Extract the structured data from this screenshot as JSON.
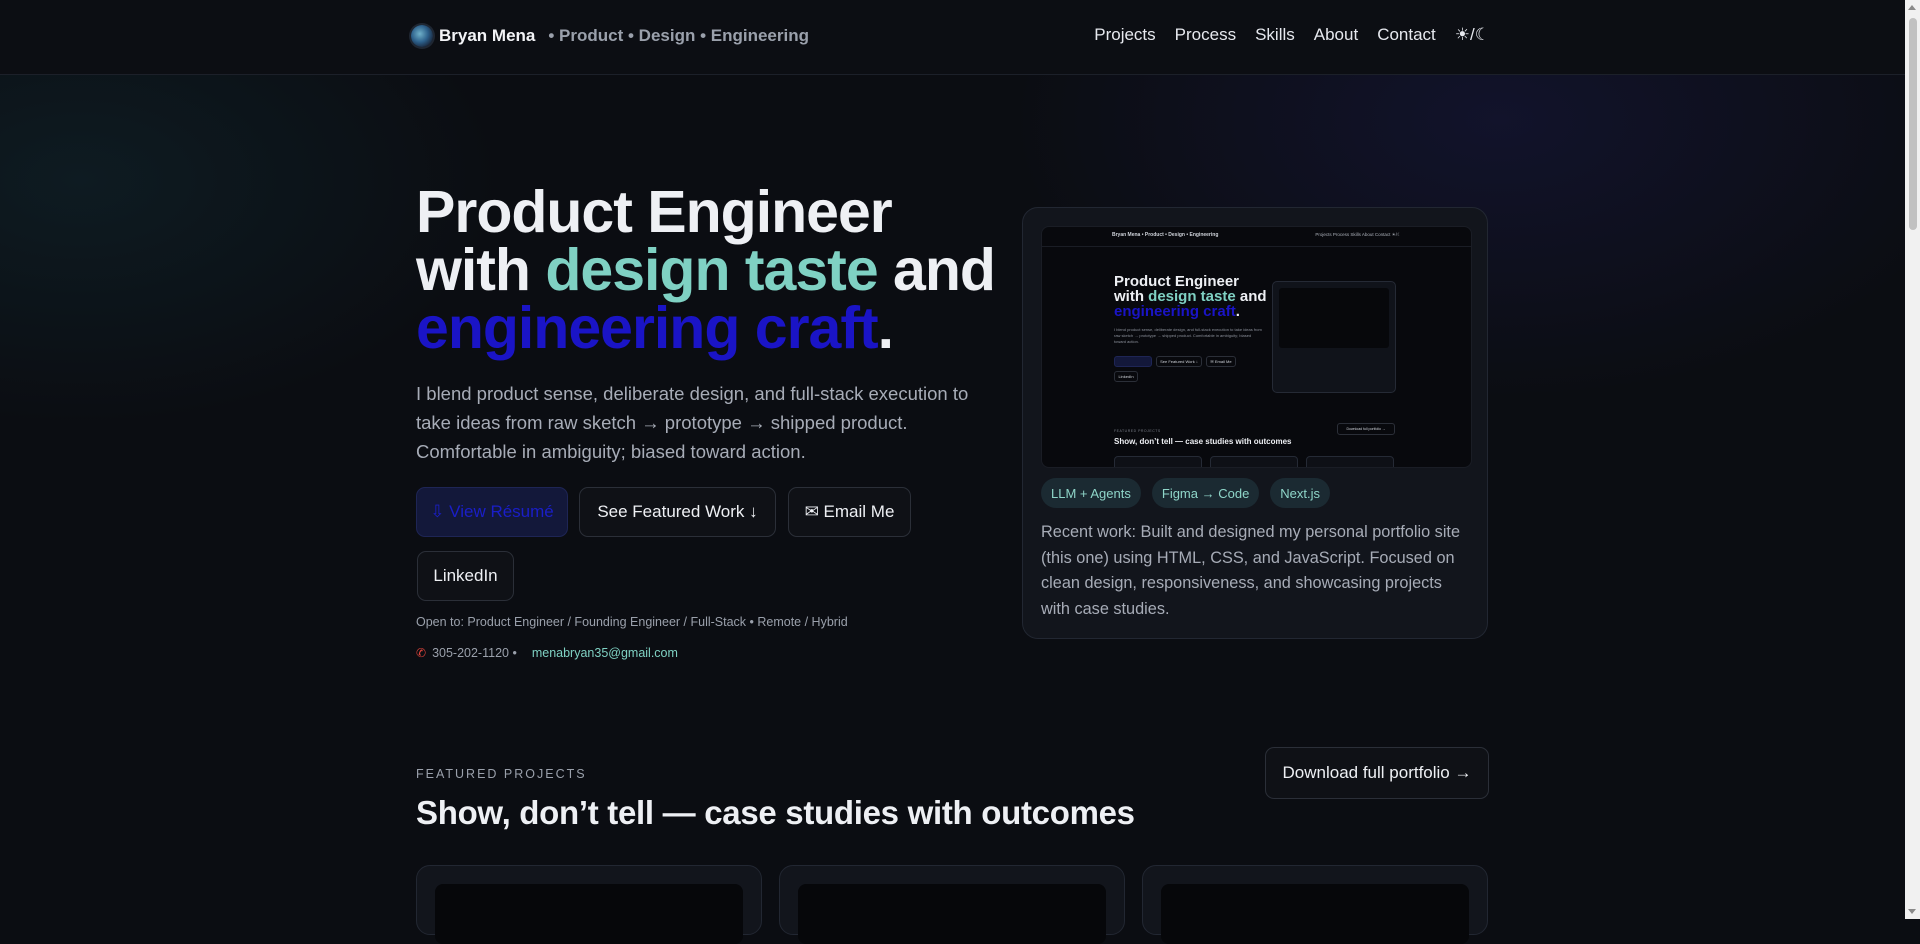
{
  "header": {
    "brand_name": "Bryan Mena",
    "brand_tagline": "• Product • Design • Engineering",
    "nav": [
      "Projects",
      "Process",
      "Skills",
      "About",
      "Contact"
    ],
    "theme_toggle": "☀/☾"
  },
  "hero": {
    "title_line1": "Product Engineer",
    "title_with": "with ",
    "title_teal": "design taste",
    "title_and": " and",
    "title_blue": "engineering craft",
    "title_period": ".",
    "subtitle": "I blend product sense, deliberate design, and full-stack execution to take ideas from raw sketch → prototype → shipped product. Comfortable in ambiguity; biased toward action.",
    "buttons": {
      "primary": "⇩ View Résumé",
      "featured": "See Featured Work ↓",
      "email": "✉ Email Me",
      "linkedin": "LinkedIn"
    },
    "open_to": "Open to: Product Engineer / Founding Engineer / Full-Stack • Remote / Hybrid",
    "phone": "305-202-1120 •",
    "email": "menabryan35@gmail.com"
  },
  "preview_card": {
    "preview": {
      "brand": "Bryan Mena • Product • Design • Engineering",
      "links": "Projects  Process  Skills  About  Contact  ☀/☾",
      "title_line1": "Product Engineer",
      "title_with": "with ",
      "title_teal": "design taste",
      "title_and": " and",
      "title_blue": "engineering craft",
      "title_period": ".",
      "sub": "I blend product sense, deliberate design, and full-stack execution to take ideas from raw sketch → prototype → shipped product. Comfortable in ambiguity; biased toward action.",
      "btn_featured": "See Featured Work ↓",
      "btn_email": "✉ Email Me",
      "btn_linkedin": "LinkedIn",
      "kicker": "FEATURED PROJECTS",
      "section": "Show, don’t tell — case studies with outcomes",
      "download": "Download full portfolio →"
    },
    "chips": [
      "LLM + Agents",
      "Figma → Code",
      "Next.js"
    ],
    "text": "Recent work: Built and designed my personal portfolio site (this one) using HTML, CSS, and JavaScript. Focused on clean design, responsiveness, and showcasing projects with case studies."
  },
  "featured": {
    "kicker": "FEATURED PROJECTS",
    "title": "Show, don’t tell — case studies with outcomes",
    "download_button": "Download full portfolio →"
  },
  "colors": {
    "background": "#0b0d12",
    "accent_teal": "#7fd1c3",
    "accent_blue": "#1a14c6"
  }
}
